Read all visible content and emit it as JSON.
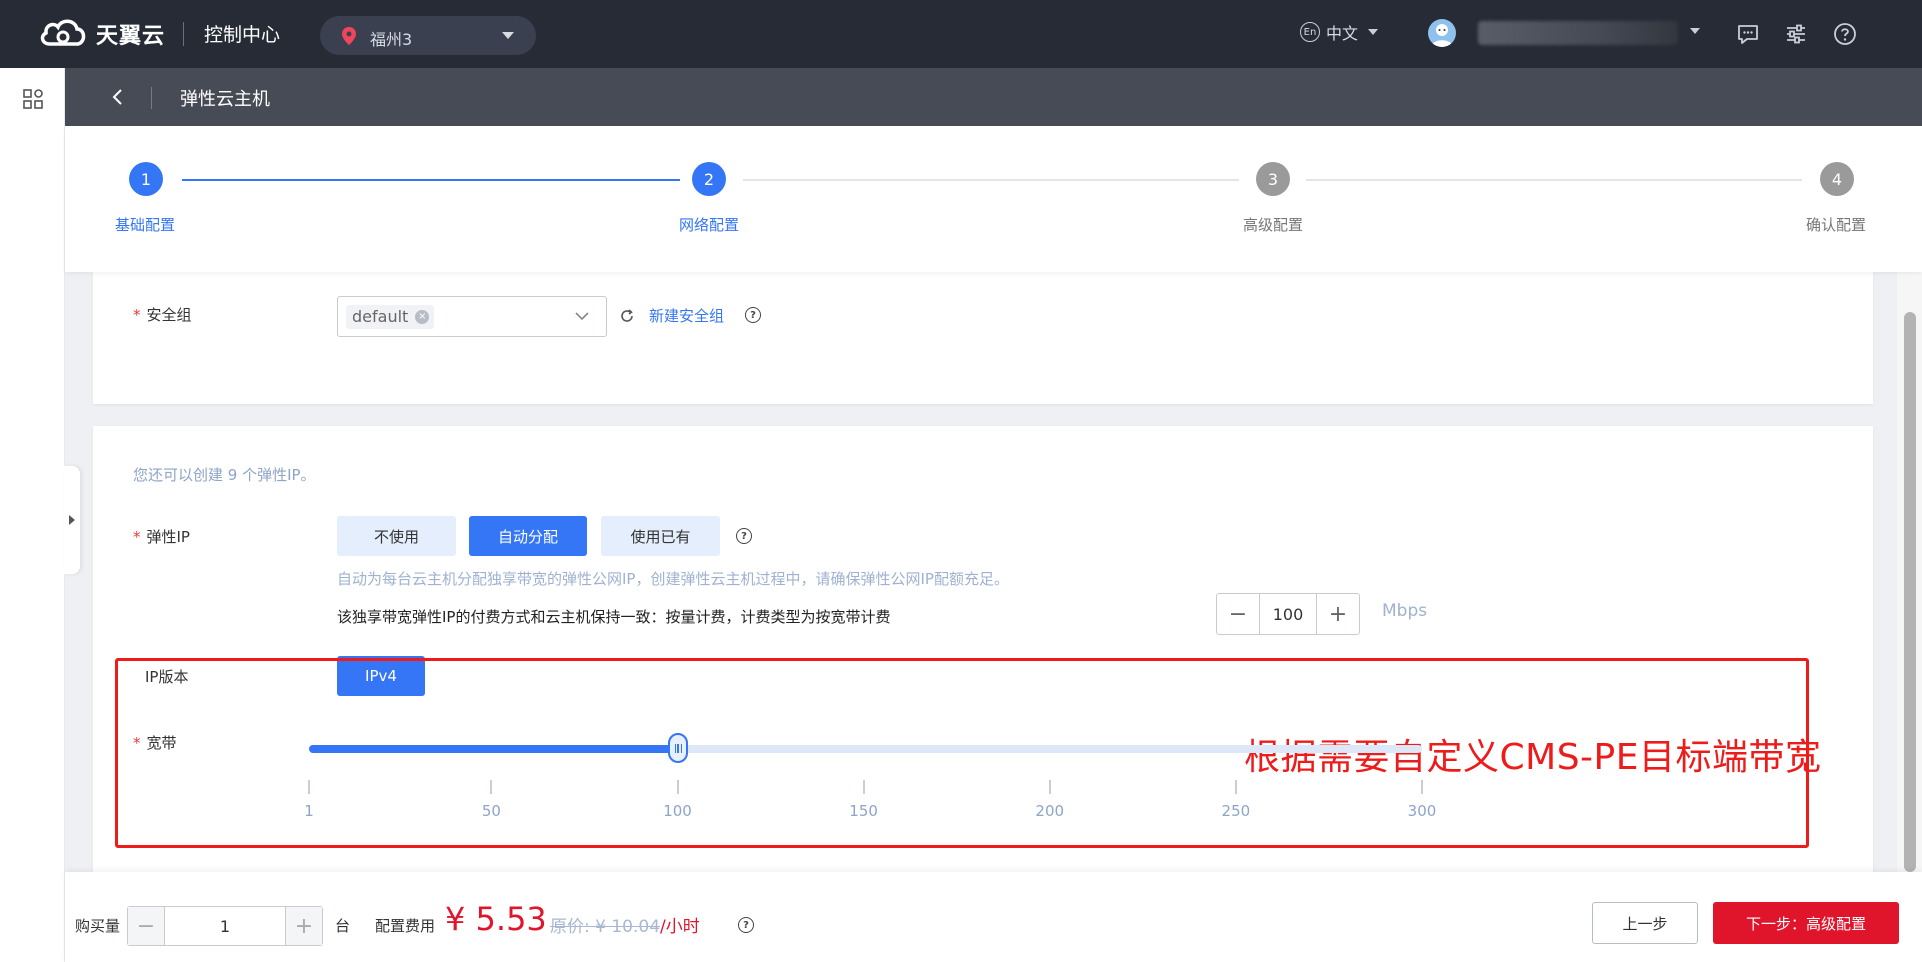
{
  "topbar": {
    "brand": "天翼云",
    "console_title": "控制中心",
    "region": "福州3",
    "language": "中文",
    "icons": [
      "cloud-logo-icon",
      "location-pin-icon",
      "en-globe-icon",
      "user-avatar-icon",
      "message-icon",
      "settings-sliders-icon",
      "help-icon"
    ]
  },
  "subheader": {
    "title": "弹性云主机"
  },
  "steps": [
    {
      "num": "1",
      "label": "基础配置"
    },
    {
      "num": "2",
      "label": "网络配置"
    },
    {
      "num": "3",
      "label": "高级配置"
    },
    {
      "num": "4",
      "label": "确认配置"
    }
  ],
  "security_group": {
    "label": "安全组",
    "selected_tag": "default",
    "new_link": "新建安全组"
  },
  "eip": {
    "quota_hint": "您还可以创建 9 个弹性IP。",
    "label": "弹性IP",
    "options": [
      "不使用",
      "自动分配",
      "使用已有"
    ],
    "selected": "自动分配",
    "description": "自动为每台云主机分配独享带宽的弹性公网IP，创建弹性云主机过程中，请确保弹性公网IP配额充足。",
    "billing_note": "该独享带宽弹性IP的付费方式和云主机保持一致：按量计费，计费类型为按宽带计费"
  },
  "callout": "根据需要自定义CMS-PE目标端带宽",
  "ip_version": {
    "label": "IP版本",
    "value": "IPv4"
  },
  "bandwidth": {
    "label": "宽带",
    "min": 1,
    "max": 300,
    "value": 100,
    "value_text": "100",
    "ticks": [
      "1",
      "50",
      "100",
      "150",
      "200",
      "250",
      "300"
    ],
    "unit": "Mbps",
    "minus": "−",
    "plus": "+"
  },
  "bottom": {
    "qty_label": "购买量",
    "qty_value": "1",
    "qty_unit": "台",
    "fee_label": "配置费用",
    "price": "¥ 5.53",
    "orig_prefix": "原价: ",
    "orig_price": "¥ 10.04",
    "per_unit": "/小时",
    "prev_button": "上一步",
    "next_button": "下一步：高级配置"
  },
  "colors": {
    "primary": "#3476f6",
    "danger": "#e0142b",
    "annotation": "#ee1b1b",
    "topbar": "#272b36"
  }
}
